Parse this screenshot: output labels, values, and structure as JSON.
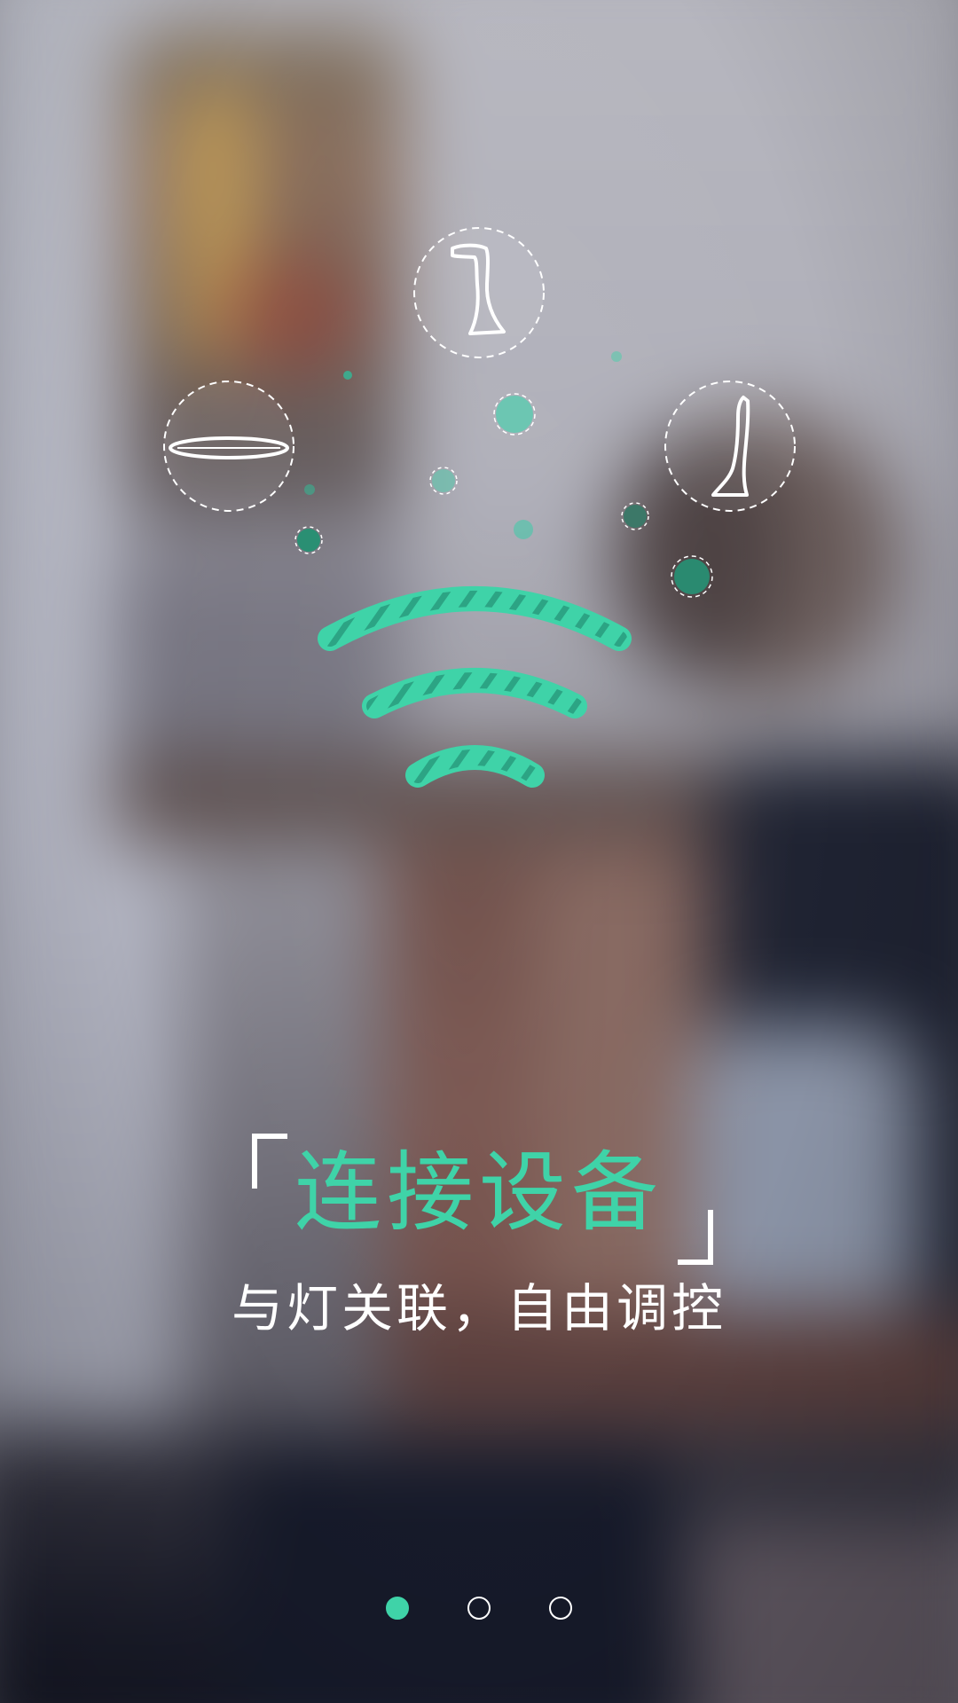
{
  "onboarding": {
    "title": "连接设备",
    "subtitle": "与灯关联，自由调控",
    "bracket_open": "「",
    "bracket_close": "」"
  },
  "illustration": {
    "devices": [
      {
        "name": "desk-lamp",
        "icon": "desk-lamp-icon"
      },
      {
        "name": "ceiling-light",
        "icon": "ceiling-light-icon"
      },
      {
        "name": "floor-lamp",
        "icon": "floor-lamp-icon"
      }
    ],
    "signal_icon": "wifi-signal-icon"
  },
  "pager": {
    "total": 3,
    "active_index": 0
  },
  "colors": {
    "accent": "#3fd3a8",
    "text": "#ffffff"
  }
}
